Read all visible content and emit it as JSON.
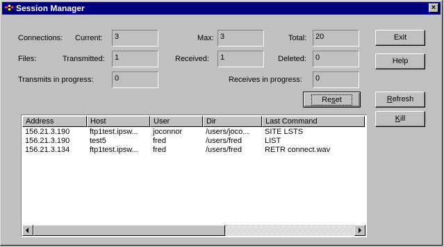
{
  "window": {
    "title": "Session Manager",
    "close_label": "×"
  },
  "stats": {
    "connections_label": "Connections:",
    "current_label": "Current:",
    "current_value": "3",
    "max_label": "Max:",
    "max_value": "3",
    "total_label": "Total:",
    "total_value": "20",
    "files_label": "Files:",
    "transmitted_label": "Transmitted:",
    "transmitted_value": "1",
    "received_label": "Received:",
    "received_value": "1",
    "deleted_label": "Deleted:",
    "deleted_value": "0",
    "transmits_label": "Transmits in progress:",
    "transmits_value": "0",
    "receives_label": "Receives in progress:",
    "receives_value": "0"
  },
  "buttons": {
    "exit": "Exit",
    "help": "Help",
    "reset_pre": "Re",
    "reset_ul": "s",
    "reset_post": "et",
    "refresh_ul": "R",
    "refresh_post": "efresh",
    "kill_ul": "K",
    "kill_post": "ill"
  },
  "sessions": {
    "columns": [
      "Address",
      "Host",
      "User",
      "Dir",
      "Last Command"
    ],
    "rows": [
      [
        "156.21.3.190",
        "ftp1test.ipsw...",
        "joconnor",
        "/users/joco...",
        "SITE LSTS"
      ],
      [
        "156.21.3.190",
        "test5",
        "fred",
        "/users/fred",
        "LIST"
      ],
      [
        "156.21.3.134",
        "ftp1test.ipsw...",
        "fred",
        "/users/fred",
        "RETR connect.wav"
      ]
    ]
  },
  "scrollbar": {
    "left_arrow": "◀",
    "right_arrow": "▶"
  }
}
